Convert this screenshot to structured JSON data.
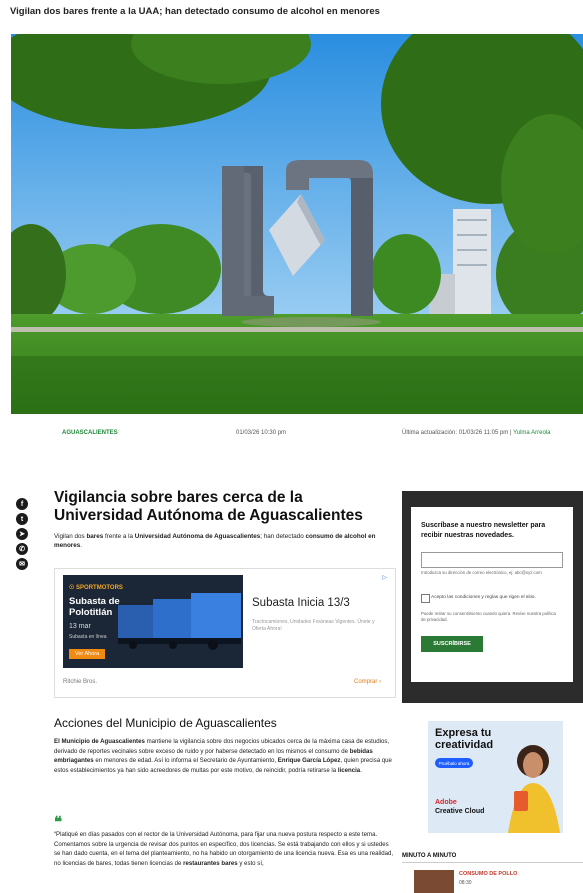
{
  "top": {
    "headline": "Vigilan dos bares frente a la UAA; han detectado consumo de alcohol en menores"
  },
  "hero": {
    "alt": ""
  },
  "meta": {
    "section": "AGUASCALIENTES",
    "date": "01/03/26 10:30 pm",
    "updated": "Última actualización: 01/03/26 11:05 pm",
    "separator": "|",
    "author": "Yulma Arreola"
  },
  "share": {
    "icons": [
      "facebook-icon",
      "twitter-icon",
      "telegram-icon",
      "whatsapp-icon",
      "messenger-icon"
    ]
  },
  "article": {
    "title": "Vigilancia sobre bares cerca de la Universidad Autónoma de Aguascalientes",
    "lead_1": "Vigilan dos ",
    "lead_b1": "bares",
    "lead_2": " frente a la ",
    "lead_b2": "Universidad Autónoma de Aguascalientes",
    "lead_3": "; han detectado ",
    "lead_b3": "consumo de alcohol en menores",
    "lead_4": ".",
    "section_title": "Acciones del Municipio de Aguascalientes",
    "p1_b1": "El Municipio de Aguascalientes",
    "p1_1": " mantiene la vigilancia sobre dos negocios ubicados cerca de la máxima casa de estudios, derivado de reportes vecinales sobre exceso de ruido y por haberse detectado en los mismos el consumo de ",
    "p1_b2": "bebidas embriagantes",
    "p1_2": " en menores de edad. Así lo informa el Secretario de Ayuntamiento, ",
    "p1_b3": "Enrique García López",
    "p1_3": ", quien precisa que estos establecimientos ya han sido acreedores de multas por este motivo, de reincidir, podría retirarse la ",
    "p1_b4": "licencia",
    "p1_4": ".",
    "quote_mark": "❝",
    "q_1": "“Platiqué en días pasados con el rector de la Universidad Autónoma, para fijar una nueva postura respecto a este tema. Comentamos sobre la urgencia de revisar dos puntos en específico, dos licencias. Se está trabajando con ellos y si ustedes se han dado cuenta, en el tema del planteamiento, no ha habido un otorgamiento de una licencia nueva. Esa es una realidad, no licencias de bares, todas tienen licencias de ",
    "q_b1": "restaurantes bares",
    "q_2": " y esto sí,"
  },
  "ad": {
    "tag": "▷",
    "brand": "☉ SPORTMOTORS",
    "img_title": "Subasta de Polotitlán",
    "img_sub": "13 mar",
    "img_small": "Subasta en línea",
    "img_cta": "Ver Ahora",
    "title": "Subasta Inicia 13/3",
    "desc": "Tractocamiones, Unidades Foráneas Vigentes. Únete y Oferta Ahora!",
    "footer": "Ritchie Bros.",
    "buy": "Comprar ›"
  },
  "newsletter": {
    "title": "Suscríbase a nuestro newsletter para recibir nuestras novedades.",
    "placeholder": "",
    "note": "Introduzca su dirección de correo electrónico, ej: abc@xyz.com",
    "checkbox": "Acepto las condiciones y reglas que rigen el sitio.",
    "legal": "Puede retirar su consentimiento cuando quiera. Revise nuestra política de privacidad.",
    "button": "SUSCRÍBIRSE"
  },
  "promo": {
    "headline": "Expresa tu creatividad",
    "cta": "Pruébalo ahora",
    "brand": "Adobe",
    "product": "Creative Cloud"
  },
  "minuto": {
    "title": "MINUTO A MINUTO",
    "item_label": "CONSUMO DE POLLO",
    "item_time": "08:30"
  },
  "colors": {
    "accent_green": "#1f8a3a",
    "button_green": "#2a7a35",
    "dark_box": "#2c2c2c"
  }
}
